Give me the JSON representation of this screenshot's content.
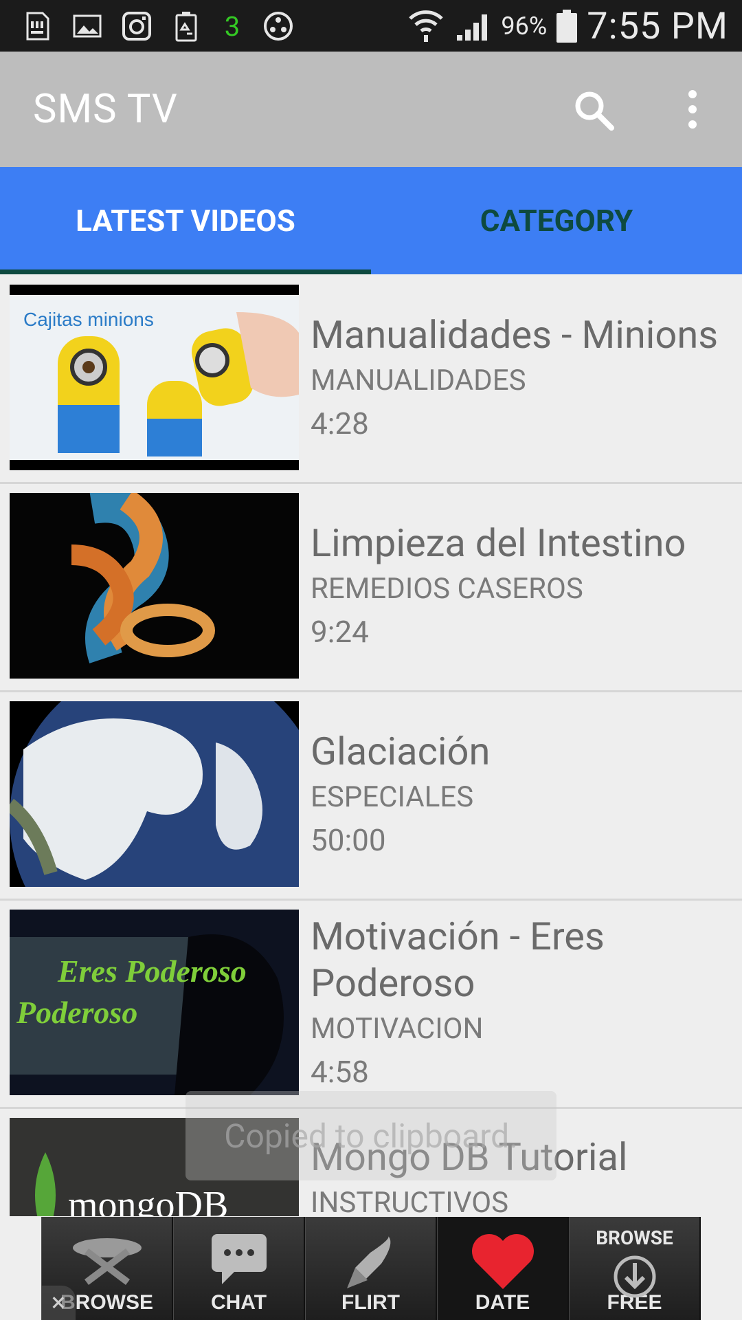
{
  "status_bar": {
    "notification_count": "3",
    "battery_percent": "96%",
    "time": "7:55 PM",
    "icons": [
      "sd-card-icon",
      "image-icon",
      "instagram-icon",
      "battery-recycle-icon",
      "counter-3",
      "settings-circle-icon",
      "wifi-icon",
      "signal-icon",
      "battery-icon"
    ]
  },
  "app_bar": {
    "title": "SMS TV",
    "icons": [
      "search-icon",
      "overflow-menu-icon"
    ]
  },
  "tabs": [
    {
      "label": "LATEST VIDEOS",
      "selected": true
    },
    {
      "label": "CATEGORY",
      "selected": false
    }
  ],
  "videos": [
    {
      "title": "Manualidades - Minions",
      "category": "MANUALIDADES",
      "duration": "4:28",
      "thumbnail_text": "Cajitas minions"
    },
    {
      "title": "Limpieza del Intestino",
      "category": "REMEDIOS CASEROS",
      "duration": "9:24"
    },
    {
      "title": "Glaciación",
      "category": "ESPECIALES",
      "duration": "50:00"
    },
    {
      "title": "Motivación - Eres Poderoso",
      "category": "MOTIVACION",
      "duration": "4:58",
      "thumbnail_text": "Eres Poderoso"
    },
    {
      "title": "Mongo DB Tutorial",
      "category": "INSTRUCTIVOS",
      "duration": "",
      "thumbnail_text": "mongoDB"
    }
  ],
  "toast": {
    "text": "Copied to clipboard."
  },
  "ad_banner": {
    "buttons": [
      {
        "label": "BROWSE",
        "top": ""
      },
      {
        "label": "CHAT",
        "top": ""
      },
      {
        "label": "FLIRT",
        "top": ""
      },
      {
        "label": "DATE",
        "top": ""
      },
      {
        "label": "FREE",
        "top": "BROWSE"
      }
    ],
    "close": "×"
  },
  "colors": {
    "tab_bar": "#3d7ef4",
    "tab_indicator": "#0e4a3f",
    "app_bar": "#bdbdbd",
    "heart": "#e8242f"
  }
}
